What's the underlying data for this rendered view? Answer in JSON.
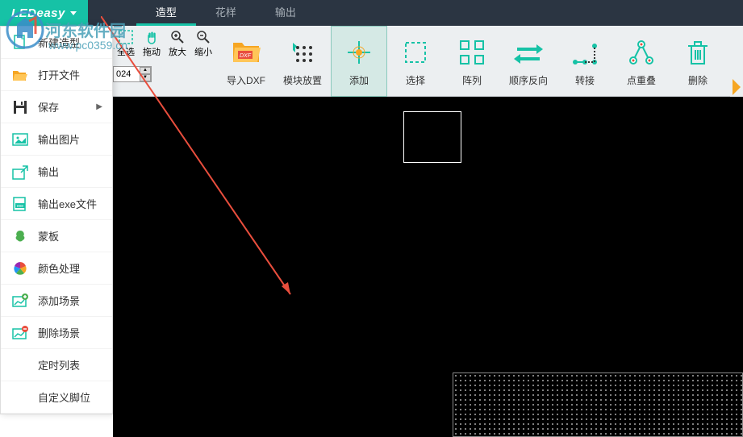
{
  "logo": "LEDeasy",
  "tabs": [
    {
      "label": "造型",
      "active": true
    },
    {
      "label": "花样",
      "active": false
    },
    {
      "label": "输出",
      "active": false
    }
  ],
  "sub_tools": [
    {
      "label": "全选"
    },
    {
      "label": "拖动"
    },
    {
      "label": "放大"
    },
    {
      "label": "缩小"
    }
  ],
  "spinner_value": "024",
  "toolbar_items": [
    {
      "label": "导入DXF"
    },
    {
      "label": "模块放置"
    },
    {
      "label": "添加",
      "selected": true
    },
    {
      "label": "选择"
    },
    {
      "label": "阵列"
    },
    {
      "label": "顺序反向"
    },
    {
      "label": "转接"
    },
    {
      "label": "点重叠"
    },
    {
      "label": "删除"
    }
  ],
  "menu_items": [
    {
      "label": "新建造型",
      "icon": "file"
    },
    {
      "label": "打开文件",
      "icon": "open"
    },
    {
      "label": "保存",
      "icon": "save",
      "has_sub": true
    },
    {
      "label": "输出图片",
      "icon": "image"
    },
    {
      "label": "输出",
      "icon": "export"
    },
    {
      "label": "输出exe文件",
      "icon": "exe"
    },
    {
      "label": "蒙板",
      "icon": "mask"
    },
    {
      "label": "颜色处理",
      "icon": "color"
    },
    {
      "label": "添加场景",
      "icon": "add-scene"
    },
    {
      "label": "删除场景",
      "icon": "del-scene"
    },
    {
      "label": "定时列表",
      "indent": true
    },
    {
      "label": "自定义脚位",
      "indent": true
    }
  ],
  "watermark": {
    "text": "河东软件园",
    "url": "www.pc0359.cn"
  }
}
